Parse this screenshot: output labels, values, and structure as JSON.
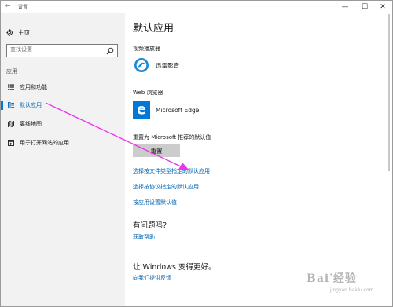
{
  "window": {
    "title": "设置",
    "back_glyph": "←",
    "min_glyph": "—",
    "max_glyph": "☐",
    "close_glyph": "✕"
  },
  "sidebar": {
    "home_label": "主页",
    "search_placeholder": "查找设置",
    "section_label": "应用",
    "items": [
      {
        "label": "应用和功能",
        "icon": "apps-list-icon"
      },
      {
        "label": "默认应用",
        "icon": "default-apps-icon",
        "active": true
      },
      {
        "label": "离线地图",
        "icon": "offline-maps-icon"
      },
      {
        "label": "用于打开网站的应用",
        "icon": "website-apps-icon"
      }
    ]
  },
  "main": {
    "title": "默认应用",
    "video_player": {
      "heading": "视频播放器",
      "app_name": "迅雷影音",
      "icon": "xunlei-player-icon"
    },
    "web_browser": {
      "heading": "Web 浏览器",
      "app_name": "Microsoft Edge",
      "icon": "edge-icon"
    },
    "reset": {
      "heading": "重置为 Microsoft 推荐的默认值",
      "button_label": "重置"
    },
    "links": [
      "选择按文件类型指定的默认应用",
      "选择按协议指定的默认应用",
      "按应用设置默认值"
    ],
    "questions": {
      "heading": "有问题吗?",
      "link": "获取帮助"
    },
    "improve": {
      "heading": "让 Windows 变得更好。",
      "link": "向我们提供反馈"
    }
  },
  "colors": {
    "accent": "#0078d7",
    "link": "#0063b1",
    "sidebar_bg": "#f2f2f2",
    "annotation_arrow": "#ee33ee",
    "xunlei_blue": "#1a8ad8",
    "edge_blue": "#0078d7"
  },
  "watermark": {
    "brand": "Bai",
    "suffix": "经验",
    "sub": "jingyan.baidu.com"
  }
}
